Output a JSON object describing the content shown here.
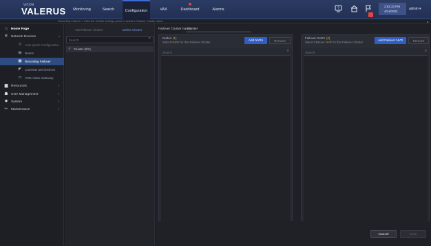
{
  "topbar": {
    "logo_top": "VICON",
    "logo_main": "VALERUS",
    "nav": [
      "Monitoring",
      "Search",
      "Configuration",
      "VAX",
      "Dashboard",
      "Alarms"
    ],
    "active_nav": "Configuration",
    "time": "2:52:33 PM",
    "date": "4/14/2021",
    "user": "admin",
    "icons": [
      "help-screen-icon",
      "lock-icon",
      "flag-icon"
    ]
  },
  "breadcrumb": {
    "text": "Recording Failover  >  Click the Cluster settings panel to select a Failover Cluster name"
  },
  "sidenav": {
    "home": "Home Page",
    "items": [
      {
        "label": "Network Devices",
        "icon": "network-icon",
        "chevron": "⌄"
      },
      {
        "label": "Auto Quick Configuration",
        "icon": "gear-icon",
        "sub": true,
        "dim": true
      },
      {
        "label": "Nodes",
        "icon": "server-icon",
        "sub": true
      },
      {
        "label": "Recording Failover",
        "icon": "failover-icon",
        "sub": true,
        "active": true
      },
      {
        "label": "Cameras and Devices",
        "icon": "camera-icon",
        "sub": true
      },
      {
        "label": "VMS Video Gateway",
        "icon": "gateway-icon",
        "sub": true
      },
      {
        "label": "Resources",
        "icon": "briefcase-icon",
        "chevron": "›"
      },
      {
        "label": "User Management",
        "icon": "user-icon",
        "chevron": "›"
      },
      {
        "label": "System",
        "icon": "system-gear-icon",
        "chevron": "›"
      },
      {
        "label": "Maintenance",
        "icon": "tools-icon",
        "chevron": "›"
      }
    ]
  },
  "col2": {
    "tab_add": "Add Failover Cluster",
    "tab_delete": "Delete Cluster",
    "search_placeholder": "Search",
    "cluster_label": "Cluster (0/1)"
  },
  "main": {
    "cluster_label": "Failover Cluster name:",
    "cluster_value": "Cluster",
    "left_panel": {
      "title": "Nodes",
      "count": "(1)",
      "subtitle": "Select NVRs for this Failover Cluster",
      "add_btn": "Add NVRs",
      "remove_btn": "Remove",
      "search_placeholder": "Search"
    },
    "right_panel": {
      "title": "Failover NVRs",
      "count": "(0)",
      "subtitle": "Select Failover NVR for this Failover Cluster",
      "add_btn": "Add Failover NVR",
      "remove_btn": "Remove",
      "search_placeholder": "Search"
    },
    "cancel": "Cancel",
    "save": "Save"
  },
  "colors": {
    "topbar": "#2b3b63",
    "accent": "#2f5fc4",
    "active_nav_item": "#2f4c82",
    "count": "#e0a23a",
    "alert": "#e5453b"
  }
}
